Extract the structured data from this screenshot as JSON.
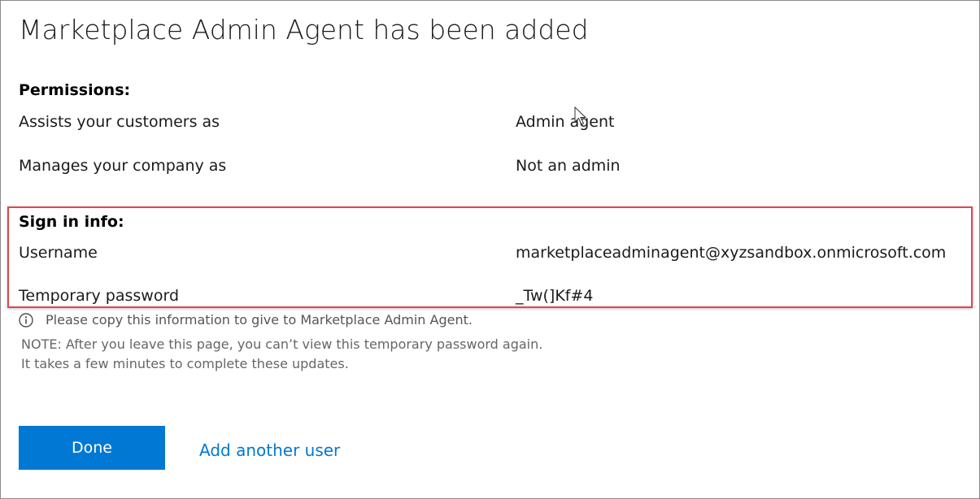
{
  "title": "Marketplace Admin Agent has been added",
  "permissions": {
    "heading": "Permissions:",
    "rows": [
      {
        "label": "Assists your customers as",
        "value": "Admin agent"
      },
      {
        "label": "Manages your company as",
        "value": "Not an admin"
      }
    ]
  },
  "sign_in": {
    "heading": "Sign in info:",
    "rows": [
      {
        "label": "Username",
        "value": "marketplaceadminagent@xyzsandbox.onmicrosoft.com"
      },
      {
        "label": "Temporary password",
        "value": "_Tw(]Kf#4"
      }
    ]
  },
  "info": {
    "icon": "info-circle-icon",
    "message": "Please copy this information to give to Marketplace Admin Agent.",
    "note_1": "NOTE: After you leave this page, you can’t view this temporary password again.",
    "note_2": "It takes a few minutes to complete these updates."
  },
  "actions": {
    "done_label": "Done",
    "add_another_label": "Add another user"
  },
  "colors": {
    "accent": "#0078d4",
    "highlight_border": "#e8424f",
    "frame_border": "#8a8a8a"
  }
}
